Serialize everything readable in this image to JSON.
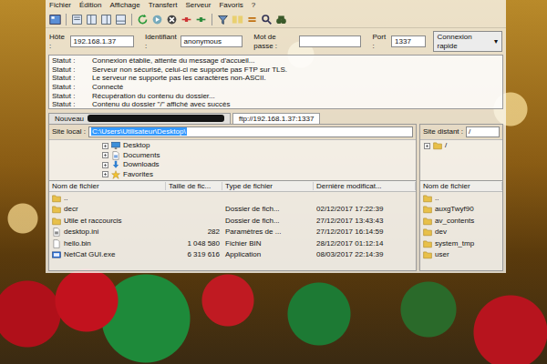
{
  "menu": [
    "Fichier",
    "Édition",
    "Affichage",
    "Transfert",
    "Serveur",
    "Favoris",
    "?"
  ],
  "quickconnect": {
    "host_label": "Hôte :",
    "host": "192.168.1.37",
    "user_label": "Identifiant :",
    "user": "anonymous",
    "password_label": "Mot de passe :",
    "password": "",
    "port_label": "Port :",
    "port": "1337",
    "button": "Connexion rapide",
    "dropdown": "▾"
  },
  "log": [
    {
      "label": "Statut :",
      "message": "Connexion établie, attente du message d'accueil..."
    },
    {
      "label": "Statut :",
      "message": "Serveur non sécurisé, celui-ci ne supporte pas FTP sur TLS."
    },
    {
      "label": "Statut :",
      "message": "Le serveur ne supporte pas les caractères non-ASCII."
    },
    {
      "label": "Statut :",
      "message": "Connecté"
    },
    {
      "label": "Statut :",
      "message": "Récupération du contenu du dossier..."
    },
    {
      "label": "Statut :",
      "message": "Contenu du dossier \"/\" affiché avec succès"
    }
  ],
  "tabs": [
    {
      "label": "Nouveau",
      "selected": false,
      "redacted": true
    },
    {
      "label": "ftp://192.168.1.37:1337",
      "selected": true,
      "redacted": false
    }
  ],
  "local": {
    "label": "Site local :",
    "path": "C:\\Users\\Utilisateur\\Desktop\\",
    "path_selected": true,
    "tree": [
      {
        "name": "Desktop",
        "kind": "desktop",
        "expanded": false
      },
      {
        "name": "Documents",
        "kind": "documents",
        "expanded": false
      },
      {
        "name": "Downloads",
        "kind": "downloads",
        "expanded": false
      },
      {
        "name": "Favorites",
        "kind": "favorites",
        "expanded": false
      }
    ],
    "columns": [
      "Nom de fichier",
      "Taille de fic...",
      "Type de fichier",
      "Dernière modificat..."
    ],
    "rows": [
      {
        "kind": "folder",
        "cells": [
          "..",
          "",
          "",
          ""
        ]
      },
      {
        "kind": "folder",
        "cells": [
          "decr",
          "",
          "Dossier de fich...",
          "02/12/2017 17:22:39"
        ]
      },
      {
        "kind": "folder",
        "cells": [
          "Utile et raccourcis",
          "",
          "Dossier de fich...",
          "27/12/2017 13:43:43"
        ]
      },
      {
        "kind": "ini",
        "cells": [
          "desktop.ini",
          "282",
          "Paramètres de ...",
          "27/12/2017 16:14:59"
        ]
      },
      {
        "kind": "bin",
        "cells": [
          "hello.bin",
          "1 048 580",
          "Fichier BIN",
          "28/12/2017 01:12:14"
        ]
      },
      {
        "kind": "exe",
        "cells": [
          "NetCat GUI.exe",
          "6 319 616",
          "Application",
          "08/03/2017 22:14:39"
        ]
      }
    ]
  },
  "remote": {
    "label": "Site distant :",
    "path": "/",
    "tree": [
      {
        "name": "/",
        "kind": "folder",
        "expanded": false
      }
    ],
    "column": "Nom de fichier",
    "rows": [
      {
        "kind": "folder",
        "name": ".."
      },
      {
        "kind": "folder",
        "name": "auxgTwyf90"
      },
      {
        "kind": "folder",
        "name": "av_contents"
      },
      {
        "kind": "folder",
        "name": "dev"
      },
      {
        "kind": "folder",
        "name": "system_tmp"
      },
      {
        "kind": "folder",
        "name": "user"
      }
    ]
  }
}
